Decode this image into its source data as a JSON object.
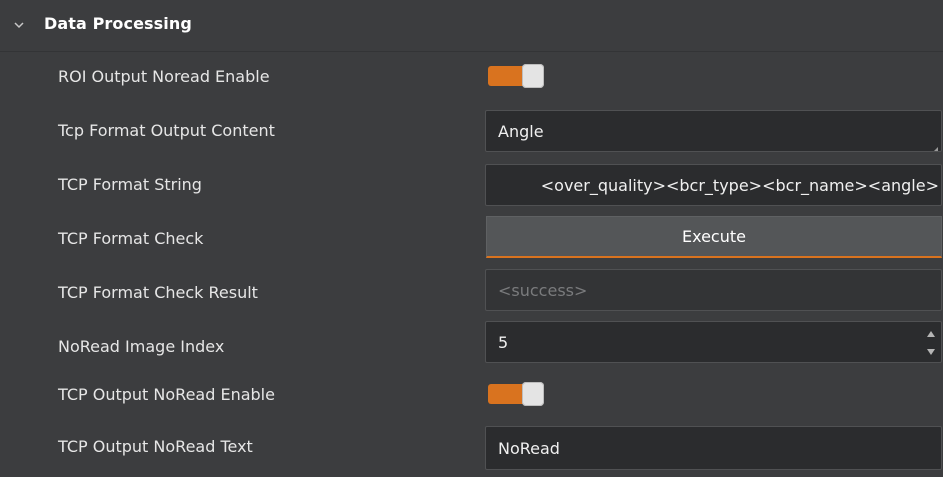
{
  "group": {
    "title": "Data Processing",
    "expanded": true
  },
  "rows": [
    {
      "label": "ROI Output Noread Enable",
      "type": "toggle",
      "value": true
    },
    {
      "label": "Tcp Format Output Content",
      "type": "text-area",
      "value": "Angle"
    },
    {
      "label": "TCP Format String",
      "type": "text",
      "value": "<over_quality><bcr_type><bcr_name><angle>"
    },
    {
      "label": "TCP Format Check",
      "type": "button",
      "value": "Execute"
    },
    {
      "label": "TCP Format Check Result",
      "type": "readonly",
      "value": "<success>"
    },
    {
      "label": "NoRead Image Index",
      "type": "spinbox",
      "value": "5"
    },
    {
      "label": "TCP Output NoRead Enable",
      "type": "toggle",
      "value": true
    },
    {
      "label": "TCP Output NoRead Text",
      "type": "text",
      "value": "NoRead"
    }
  ],
  "colors": {
    "background": "#3c3d3f",
    "field_bg": "#2b2c2e",
    "accent": "#d9731f",
    "button_bg": "#545658"
  }
}
